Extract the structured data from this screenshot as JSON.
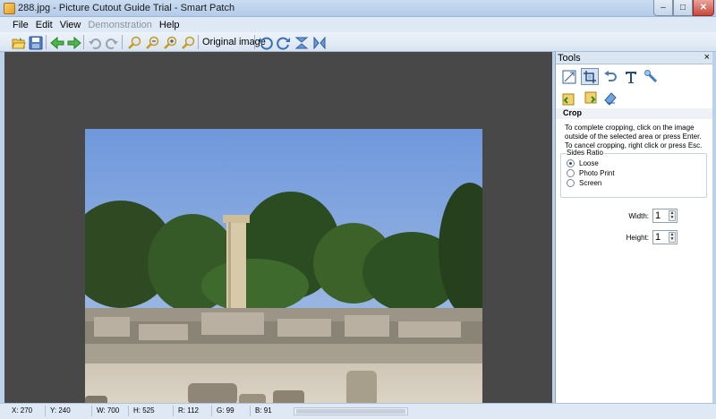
{
  "window": {
    "title": "288.jpg - Picture Cutout Guide Trial - Smart Patch",
    "min_glyph": "–",
    "max_glyph": "□",
    "close_glyph": "✕"
  },
  "menu": {
    "items": [
      {
        "label": "File"
      },
      {
        "label": "Edit"
      },
      {
        "label": "View"
      },
      {
        "label": "Demonstration"
      },
      {
        "label": "Help"
      }
    ]
  },
  "toolbar": {
    "original_image_label": "Original image",
    "icons": [
      "open-folder-icon",
      "save-icon",
      "back-arrow-icon",
      "forward-arrow-icon",
      "undo-icon",
      "redo-icon",
      "zoom-fit-icon",
      "zoom-out-icon",
      "zoom-in-icon",
      "zoom-actual-icon",
      "rotate-left-icon",
      "rotate-right-icon",
      "flip-vertical-icon",
      "flip-horizontal-icon"
    ]
  },
  "tools_panel": {
    "title": "Tools",
    "close_glyph": "×",
    "section_title": "Crop",
    "description": "To complete cropping, click on the image outside of the selected area or press Enter. To cancel cropping, right click or press Esc.",
    "sides_ratio": {
      "label": "Sides Ratio",
      "options": [
        {
          "label": "Loose",
          "checked": true
        },
        {
          "label": "Photo Print",
          "checked": false
        },
        {
          "label": "Screen",
          "checked": false
        }
      ]
    },
    "width_label": "Width:",
    "width_value": "1",
    "height_label": "Height:",
    "height_value": "1"
  },
  "status": {
    "x": "X: 270",
    "y": "Y: 240",
    "w": "W: 700",
    "h": "H: 525",
    "r": "R: 112",
    "g": "G: 99",
    "b": "B: 91"
  }
}
